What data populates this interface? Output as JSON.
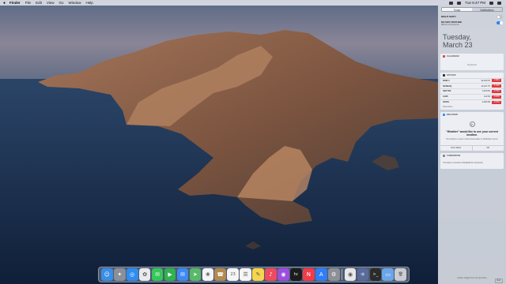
{
  "menubar": {
    "apple_icon": "apple-icon",
    "app_name": "Finder",
    "items": [
      "File",
      "Edit",
      "View",
      "Go",
      "Window",
      "Help"
    ],
    "clock": "Tue 6:47 PM"
  },
  "notification_center": {
    "tabs": [
      "Today",
      "Notifications"
    ],
    "night_shift": {
      "label": "NIGHT SHIFT",
      "on": false
    },
    "do_not_disturb": {
      "label": "DO NOT DISTURB",
      "sub": "Will turn off tomorrow",
      "on": true
    },
    "date": {
      "weekday": "Tuesday,",
      "day": "March 23"
    },
    "calendar": {
      "title": "CALENDAR",
      "empty": "No Events"
    },
    "stocks": {
      "title": "STOCKS",
      "rows": [
        {
          "symbol": "DOW J",
          "price": "32,423.15",
          "change": "-0.86%"
        },
        {
          "symbol": "NASDAQ",
          "price": "13,227.70",
          "change": "-1.12%"
        },
        {
          "symbol": "S&P 500",
          "price": "3,910.52",
          "change": "-0.76%"
        },
        {
          "symbol": "AAPL",
          "price": "122.54",
          "change": "-0.24%"
        },
        {
          "symbol": "GOOG",
          "price": "2,052.96",
          "change": "-0.10%"
        }
      ],
      "show_more": "Show More..."
    },
    "weather": {
      "title": "WEATHER",
      "prompt": "\"Weather\" would like to use your current location.",
      "sub": "Your location is used to show local weather in Notification Center.",
      "dont_allow": "Don't Allow",
      "ok": "OK"
    },
    "tomorrow": {
      "title": "TOMORROW",
      "text": "You have no events scheduled for tomorrow."
    },
    "footer": "Today's widgets from the App Store",
    "edit": "Edit"
  },
  "dock": {
    "apps": [
      {
        "name": "finder-icon",
        "glyph": "☺",
        "color": "#3a8ee6"
      },
      {
        "name": "launchpad-icon",
        "glyph": "✦",
        "color": "#8a8f98"
      },
      {
        "name": "safari-icon",
        "glyph": "◎",
        "color": "#2f8cf0"
      },
      {
        "name": "photos-icon",
        "glyph": "✿",
        "color": "#e9e9ee"
      },
      {
        "name": "messages-icon",
        "glyph": "✉",
        "color": "#35c759"
      },
      {
        "name": "facetime-icon",
        "glyph": "▶",
        "color": "#2fb34f"
      },
      {
        "name": "mail-icon",
        "glyph": "✉",
        "color": "#3d8bf2"
      },
      {
        "name": "maps-icon",
        "glyph": "➤",
        "color": "#58b96a"
      },
      {
        "name": "photos-app-icon",
        "glyph": "❀",
        "color": "#f4f4f6"
      },
      {
        "name": "contacts-icon",
        "glyph": "☎",
        "color": "#b48a52"
      },
      {
        "name": "calendar-icon",
        "glyph": "23",
        "color": "#f5f5f5"
      },
      {
        "name": "reminders-icon",
        "glyph": "☰",
        "color": "#f5f5f5"
      },
      {
        "name": "notes-icon",
        "glyph": "✎",
        "color": "#f6d44e"
      },
      {
        "name": "music-icon",
        "glyph": "♪",
        "color": "#f04a5e"
      },
      {
        "name": "podcasts-icon",
        "glyph": "◉",
        "color": "#9b4ee0"
      },
      {
        "name": "tv-icon",
        "glyph": "tv",
        "color": "#1c1c1e"
      },
      {
        "name": "news-icon",
        "glyph": "N",
        "color": "#f23b4a"
      },
      {
        "name": "app-store-icon",
        "glyph": "A",
        "color": "#2f7ef6"
      },
      {
        "name": "system-preferences-icon",
        "glyph": "⚙",
        "color": "#8e9096"
      },
      {
        "name": "chrome-icon",
        "glyph": "◉",
        "color": "#e8e8ea"
      },
      {
        "name": "atom-icon",
        "glyph": "⚛",
        "color": "#5a6a9a"
      },
      {
        "name": "terminal-icon",
        "glyph": ">_",
        "color": "#2b2b2b"
      },
      {
        "name": "folder-icon",
        "glyph": "▭",
        "color": "#6aa6e8"
      },
      {
        "name": "trash-icon",
        "glyph": "🗑",
        "color": "#c9ccd2"
      }
    ]
  }
}
